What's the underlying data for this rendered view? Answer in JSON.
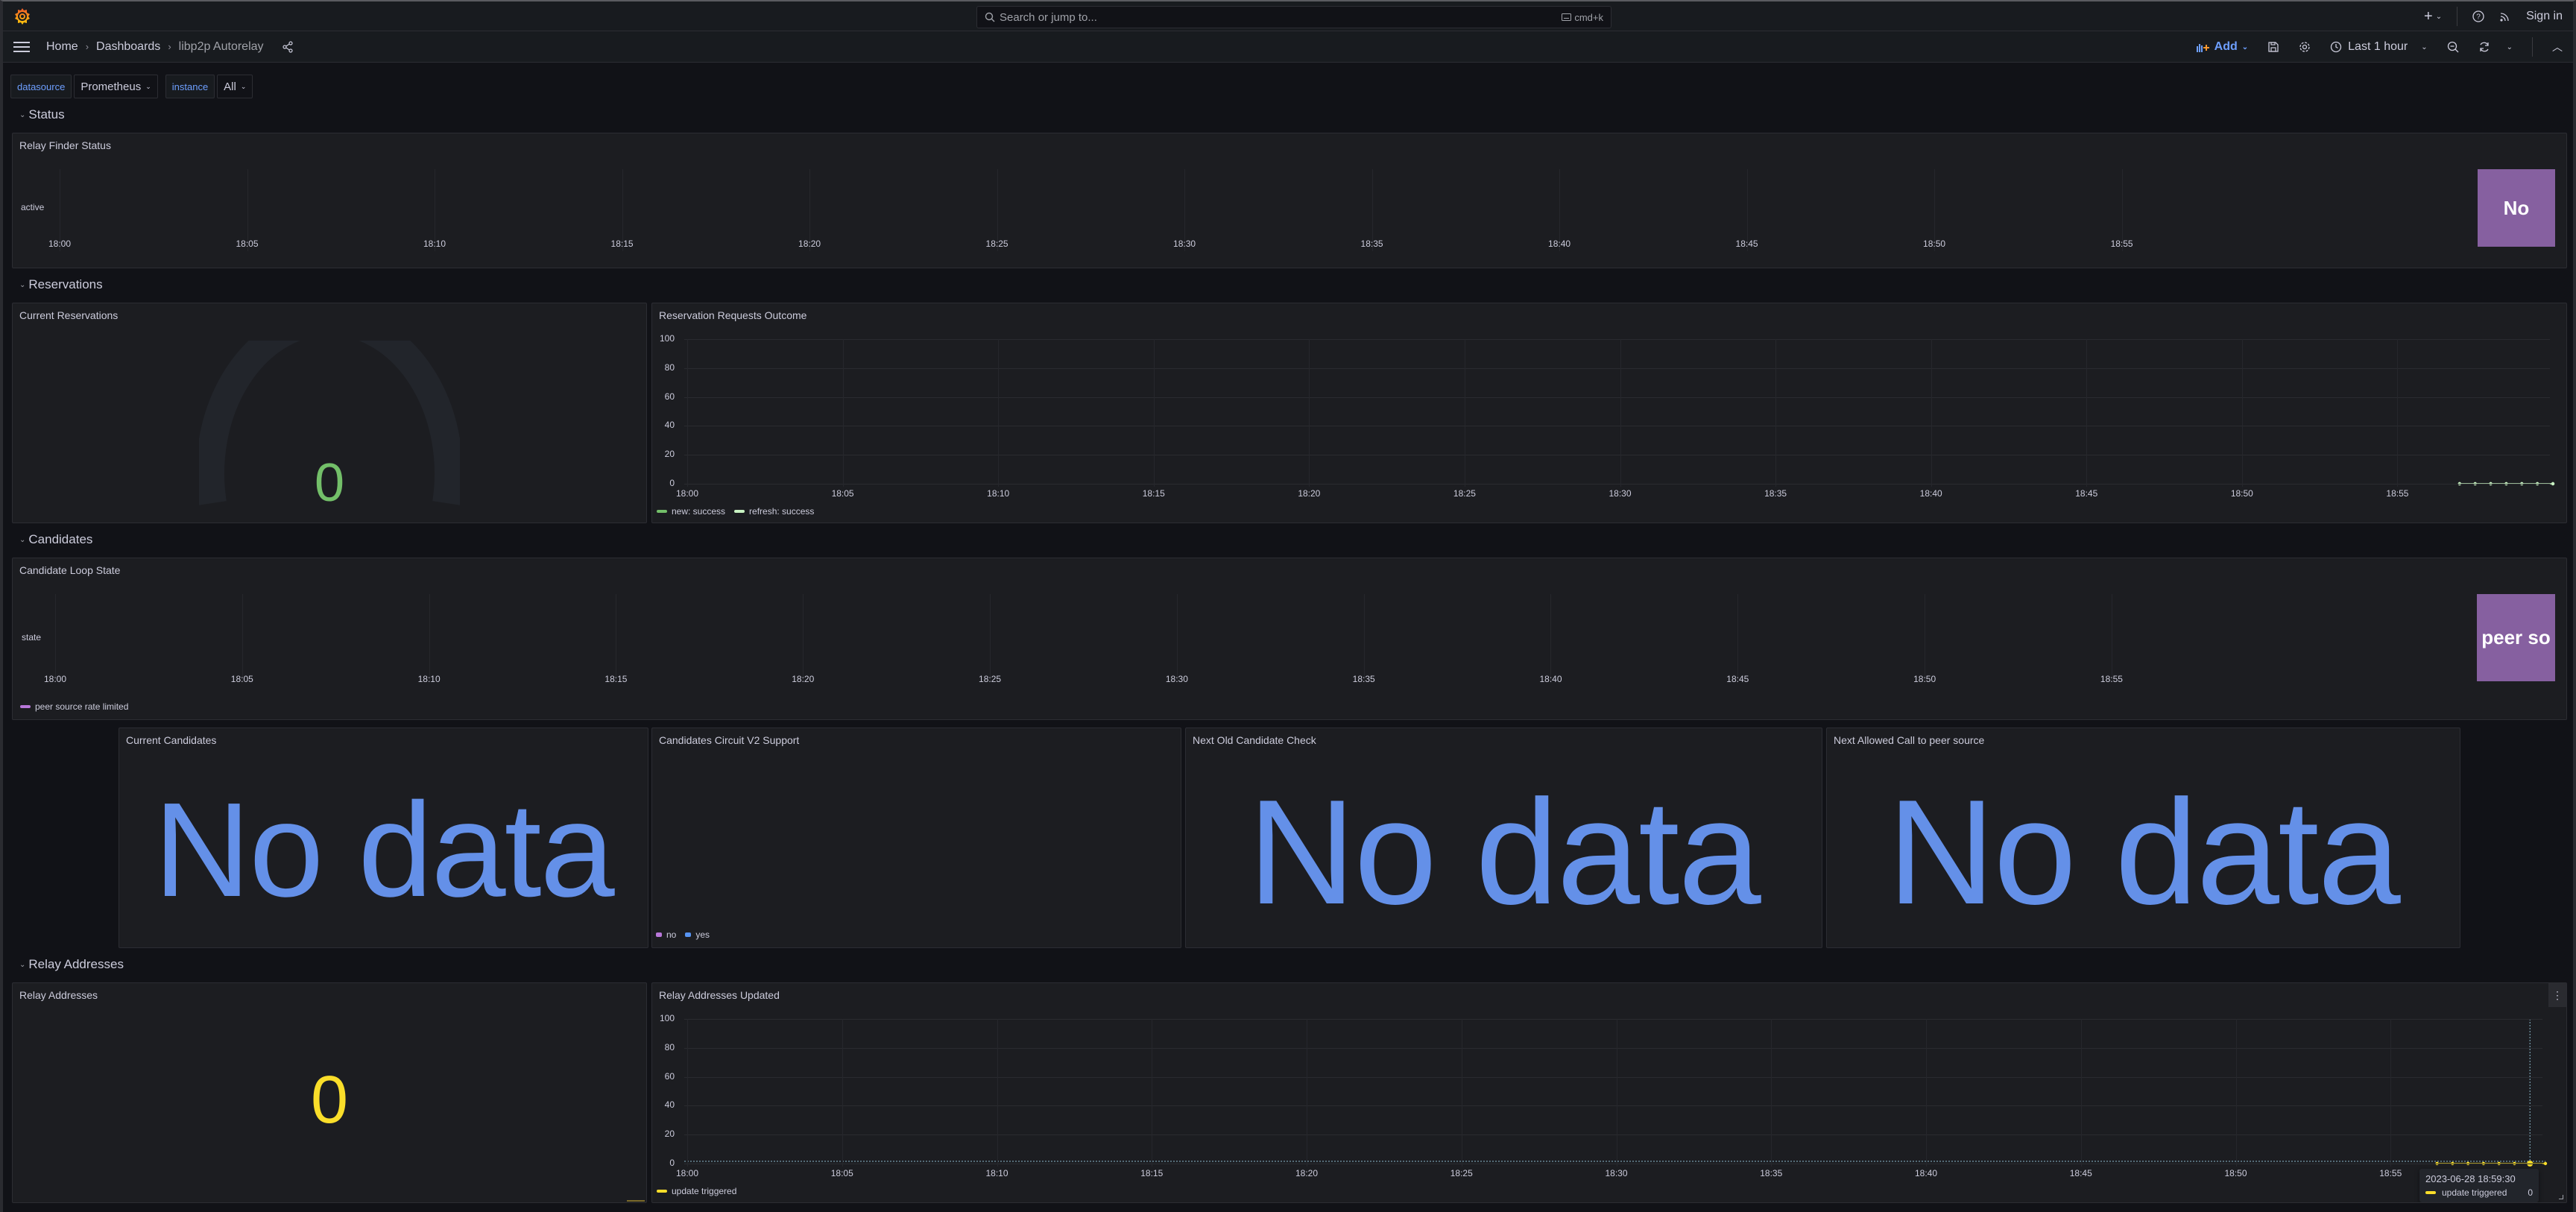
{
  "topbar": {
    "search_placeholder": "Search or jump to...",
    "search_shortcut": "cmd+k",
    "sign_in": "Sign in",
    "new_icon": "plus-icon",
    "help_icon": "help-icon",
    "news_icon": "rss-icon"
  },
  "breadcrumb": {
    "items": [
      "Home",
      "Dashboards",
      "libp2p Autorelay"
    ]
  },
  "toolbar": {
    "add_label": "Add",
    "time_range": "Last 1 hour"
  },
  "variables": [
    {
      "label": "datasource",
      "value": "Prometheus"
    },
    {
      "label": "instance",
      "value": "All"
    }
  ],
  "rows": {
    "status": "Status",
    "reservations": "Reservations",
    "candidates": "Candidates",
    "relay_addresses": "Relay Addresses"
  },
  "time_ticks": [
    "18:00",
    "18:05",
    "18:10",
    "18:15",
    "18:20",
    "18:25",
    "18:30",
    "18:35",
    "18:40",
    "18:45",
    "18:50",
    "18:55"
  ],
  "panels": {
    "relay_finder_status": {
      "title": "Relay Finder Status",
      "row_label": "active",
      "state_value": "No",
      "state_color": "#8660a0"
    },
    "current_reservations": {
      "title": "Current Reservations",
      "value": "0",
      "value_color": "#73bf69"
    },
    "reservation_requests_outcome": {
      "title": "Reservation Requests Outcome",
      "y_ticks": [
        "100",
        "80",
        "60",
        "40",
        "20",
        "0"
      ],
      "legend": [
        {
          "label": "new: success",
          "color": "#73bf69"
        },
        {
          "label": "refresh: success",
          "color": "#c8f2c2"
        }
      ]
    },
    "candidate_loop_state": {
      "title": "Candidate Loop State",
      "row_label": "state",
      "state_value": "peer so",
      "state_color": "#8660a0",
      "legend": [
        {
          "label": "peer source rate limited",
          "color": "#b877d9"
        }
      ]
    },
    "current_candidates": {
      "title": "Current Candidates",
      "value": "No data"
    },
    "circuit_v2_support": {
      "title": "Candidates Circuit V2 Support",
      "legend": [
        {
          "label": "no",
          "color": "#b877d9"
        },
        {
          "label": "yes",
          "color": "#5794f2"
        }
      ]
    },
    "next_old_candidate_check": {
      "title": "Next Old Candidate Check",
      "value": "No data"
    },
    "next_allowed_call": {
      "title": "Next Allowed Call to peer source",
      "value": "No data"
    },
    "relay_addresses": {
      "title": "Relay Addresses",
      "value": "0",
      "value_color": "#fade2a"
    },
    "relay_addresses_updated": {
      "title": "Relay Addresses Updated",
      "y_ticks": [
        "100",
        "80",
        "60",
        "40",
        "20",
        "0"
      ],
      "legend": [
        {
          "label": "update triggered",
          "color": "#fade2a"
        }
      ],
      "tooltip": {
        "time": "2023-06-28 18:59:30",
        "series": "update triggered",
        "value": "0"
      }
    }
  },
  "chart_data": [
    {
      "type": "line",
      "title": "Reservation Requests Outcome",
      "x": [
        "18:57:00",
        "18:57:30",
        "18:58:00",
        "18:58:30",
        "18:59:00",
        "18:59:30",
        "19:00:00"
      ],
      "series": [
        {
          "name": "new: success",
          "values": [
            0,
            0,
            0,
            0,
            0,
            0,
            0
          ]
        },
        {
          "name": "refresh: success",
          "values": [
            0,
            0,
            0,
            0,
            0,
            0,
            0
          ]
        }
      ],
      "ylim": [
        0,
        100
      ],
      "xlabel": "",
      "ylabel": "",
      "legend": "bottom-left"
    },
    {
      "type": "line",
      "title": "Relay Addresses Updated",
      "x": [
        "18:56:30",
        "18:57:00",
        "18:57:30",
        "18:58:00",
        "18:58:30",
        "18:59:00",
        "18:59:30",
        "19:00:00"
      ],
      "series": [
        {
          "name": "update triggered",
          "values": [
            0,
            0,
            0,
            0,
            0,
            0,
            0,
            0
          ]
        }
      ],
      "ylim": [
        0,
        100
      ],
      "xlabel": "",
      "ylabel": "",
      "legend": "bottom-left"
    }
  ]
}
